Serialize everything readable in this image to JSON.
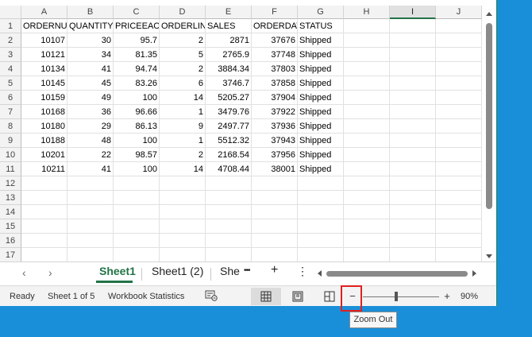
{
  "sheet": {
    "columns": [
      "A",
      "B",
      "C",
      "D",
      "E",
      "F",
      "G",
      "H",
      "I",
      "J"
    ],
    "selected_column": "I",
    "row_numbers": [
      "1",
      "2",
      "3",
      "4",
      "5",
      "6",
      "7",
      "8",
      "9",
      "10",
      "11",
      "12",
      "13",
      "14",
      "15",
      "16",
      "17"
    ],
    "headers": [
      "ORDERNUMBER",
      "QUANTITYORDERED",
      "PRICEEACH",
      "ORDERLINENUMBER",
      "SALES",
      "ORDERDATE",
      "STATUS"
    ],
    "rows": [
      [
        "10107",
        "30",
        "95.7",
        "2",
        "2871",
        "37676",
        "Shipped"
      ],
      [
        "10121",
        "34",
        "81.35",
        "5",
        "2765.9",
        "37748",
        "Shipped"
      ],
      [
        "10134",
        "41",
        "94.74",
        "2",
        "3884.34",
        "37803",
        "Shipped"
      ],
      [
        "10145",
        "45",
        "83.26",
        "6",
        "3746.7",
        "37858",
        "Shipped"
      ],
      [
        "10159",
        "49",
        "100",
        "14",
        "5205.27",
        "37904",
        "Shipped"
      ],
      [
        "10168",
        "36",
        "96.66",
        "1",
        "3479.76",
        "37922",
        "Shipped"
      ],
      [
        "10180",
        "29",
        "86.13",
        "9",
        "2497.77",
        "37936",
        "Shipped"
      ],
      [
        "10188",
        "48",
        "100",
        "1",
        "5512.32",
        "37943",
        "Shipped"
      ],
      [
        "10201",
        "22",
        "98.57",
        "2",
        "2168.54",
        "37956",
        "Shipped"
      ],
      [
        "10211",
        "41",
        "100",
        "14",
        "4708.44",
        "38001",
        "Shipped"
      ]
    ]
  },
  "tabs": {
    "prev_icon": "chevron-left-icon",
    "prev_glyph": "‹",
    "next_icon": "chevron-right-icon",
    "next_glyph": "›",
    "items": [
      "Sheet1",
      "Sheet1 (2)",
      "She"
    ],
    "active_index": 0,
    "more_glyph": "•••",
    "add_glyph": "+",
    "options_glyph": "⋮"
  },
  "status": {
    "ready": "Ready",
    "sheet_info": "Sheet 1 of 5",
    "workbook_stats": "Workbook Statistics",
    "accessibility_icon": "accessibility-icon",
    "views": [
      "normal-view-icon",
      "page-layout-view-icon",
      "page-break-preview-icon"
    ],
    "active_view_index": 0,
    "zoom_out_glyph": "−",
    "zoom_in_glyph": "+",
    "zoom_level": "90%",
    "zoom_fraction": 0.9
  },
  "tooltip": {
    "text": "Zoom Out"
  },
  "colors": {
    "accent": "#217346",
    "desktop": "#1a8fd9",
    "highlight": "#e02020"
  }
}
